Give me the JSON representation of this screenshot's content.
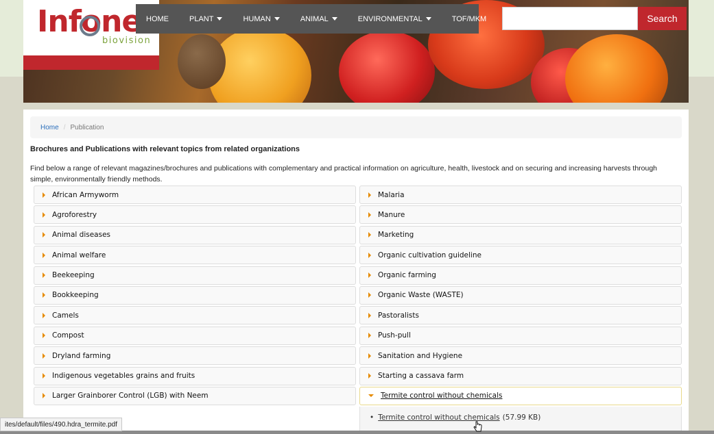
{
  "logo": {
    "main": "Infonet",
    "sub": "biovision"
  },
  "nav": {
    "items": [
      {
        "label": "HOME",
        "dropdown": false
      },
      {
        "label": "PLANT",
        "dropdown": true
      },
      {
        "label": "HUMAN",
        "dropdown": true
      },
      {
        "label": "ANIMAL",
        "dropdown": true
      },
      {
        "label": "ENVIRONMENTAL",
        "dropdown": true
      },
      {
        "label": "TOF/MKM",
        "dropdown": false
      }
    ]
  },
  "search": {
    "placeholder": "",
    "button_label": "Search"
  },
  "breadcrumb": {
    "home": "Home",
    "separator": "/",
    "current": "Publication"
  },
  "heading": "Brochures and Publications with relevant topics from related organizations",
  "intro": "Find below a range of relevant magazines/brochures and publications with complementary and practical information on agriculture, health, livestock and on securing and increasing harvests through simple, environmentally friendly methods.",
  "accordion": {
    "left": [
      "African Armyworm",
      "Agroforestry",
      "Animal diseases",
      "Animal welfare",
      "Beekeeping",
      "Bookkeeping",
      "Camels",
      "Compost",
      "Dryland farming",
      "Indigenous vegetables grains and fruits",
      "Larger Grainborer Control (LGB) with Neem"
    ],
    "right": [
      "Malaria",
      "Manure",
      "Marketing",
      "Organic cultivation guideline",
      "Organic farming",
      "Organic Waste (WASTE)",
      "Pastoralists",
      "Push-pull",
      "Sanitation and Hygiene",
      "Starting a cassava farm",
      "Termite control without chemicals"
    ],
    "open_item": {
      "title": "Termite control without chemicals",
      "file_link": "Termite control without chemicals",
      "file_size": "(57.99 KB)"
    }
  },
  "status_bar": {
    "url": "ites/default/files/490.hdra_termite.pdf"
  },
  "colors": {
    "brand_red": "#c0272d",
    "nav_gray": "#555555",
    "accent_orange": "#e68a00",
    "logo_green": "#7ca33c"
  }
}
